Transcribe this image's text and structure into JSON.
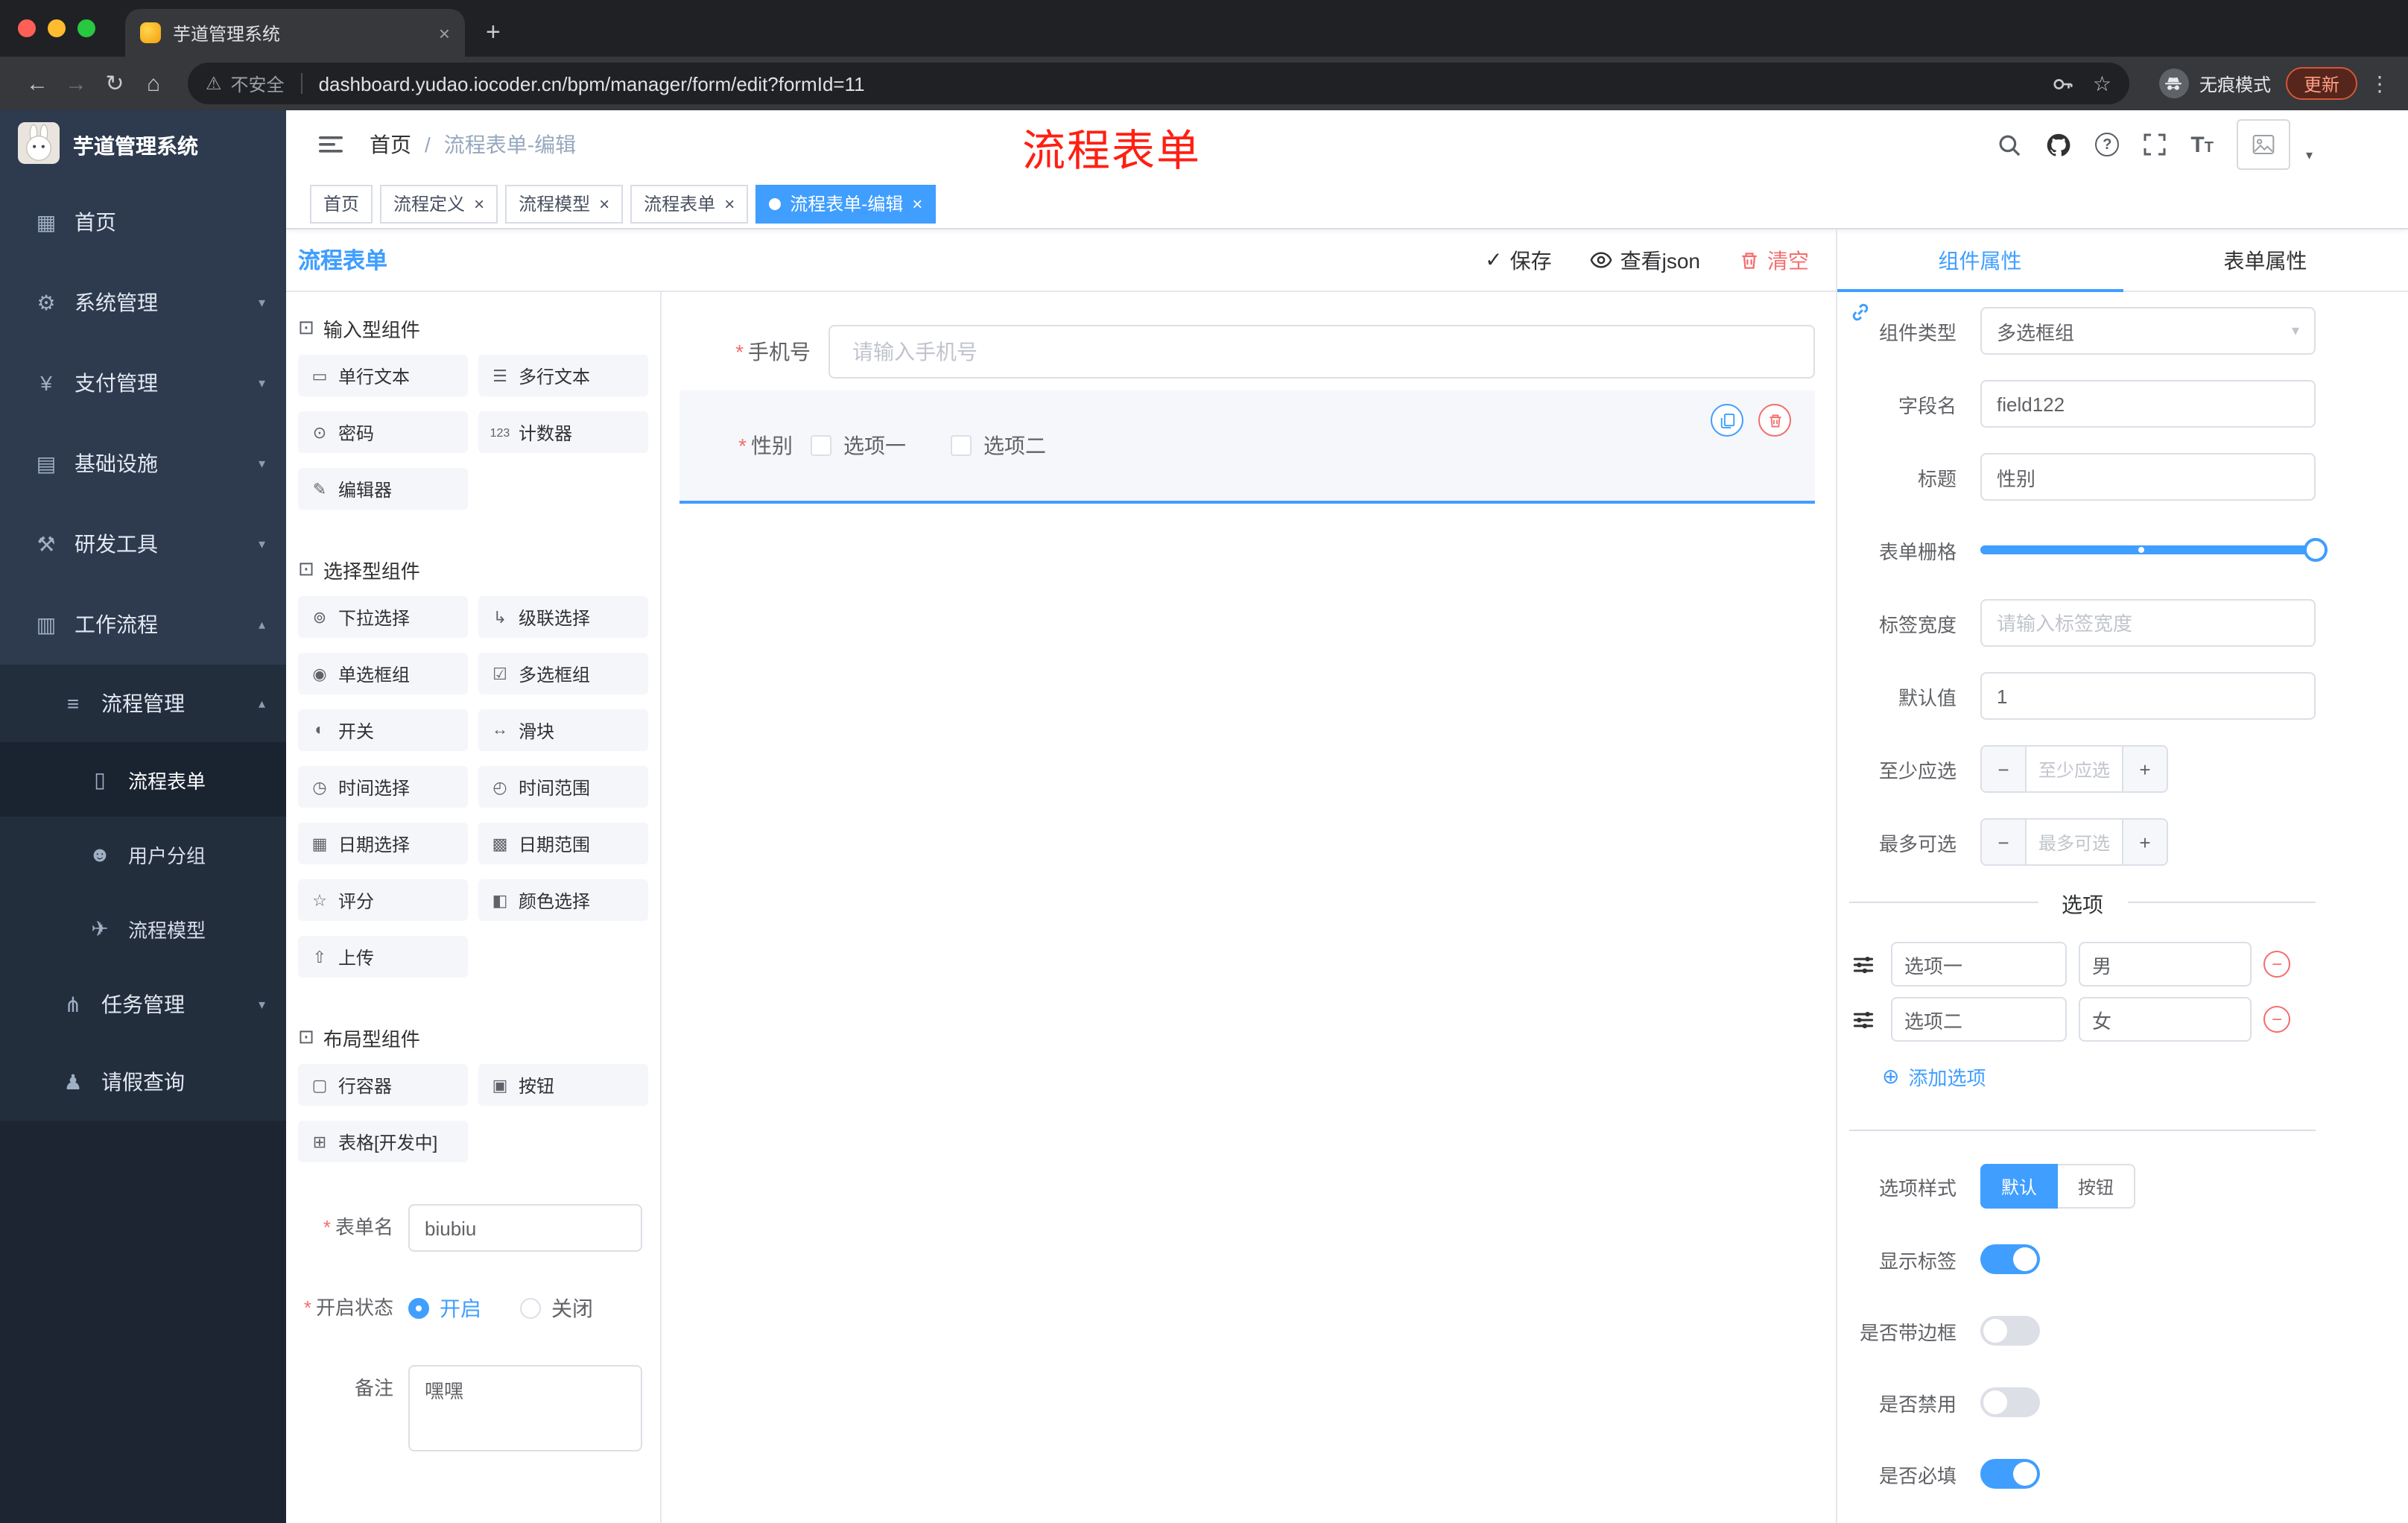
{
  "colors": {
    "primary": "#409eff",
    "danger": "#f56c6c",
    "annotation_red": "#ff1f12",
    "sidebar_bg": "#2e3a4e",
    "active_tag": "#409eff"
  },
  "browser": {
    "tab_title": "芋道管理系统",
    "security_label": "不安全",
    "url": "dashboard.yudao.iocoder.cn/bpm/manager/form/edit?formId=11",
    "incognito_label": "无痕模式",
    "update_label": "更新"
  },
  "sidebar": {
    "brand": "芋道管理系统",
    "items": [
      {
        "label": "首页"
      },
      {
        "label": "系统管理"
      },
      {
        "label": "支付管理"
      },
      {
        "label": "基础设施"
      },
      {
        "label": "研发工具"
      },
      {
        "label": "工作流程"
      },
      {
        "label": "流程管理"
      },
      {
        "label": "流程表单"
      },
      {
        "label": "用户分组"
      },
      {
        "label": "流程模型"
      },
      {
        "label": "任务管理"
      },
      {
        "label": "请假查询"
      }
    ]
  },
  "header": {
    "breadcrumb_home": "首页",
    "breadcrumb_sep": "/",
    "breadcrumb_current": "流程表单-编辑",
    "annotation": "流程表单"
  },
  "tags": [
    {
      "label": "首页"
    },
    {
      "label": "流程定义"
    },
    {
      "label": "流程模型"
    },
    {
      "label": "流程表单"
    },
    {
      "label": "流程表单-编辑"
    }
  ],
  "toolbar": {
    "save": "保存",
    "view_json": "查看json",
    "clear": "清空"
  },
  "palette": {
    "title": "流程表单",
    "groups": [
      {
        "title": "输入型组件",
        "items": [
          "单行文本",
          "多行文本",
          "密码",
          "计数器",
          "编辑器"
        ]
      },
      {
        "title": "选择型组件",
        "items": [
          "下拉选择",
          "级联选择",
          "单选框组",
          "多选框组",
          "开关",
          "滑块",
          "时间选择",
          "时间范围",
          "日期选择",
          "日期范围",
          "评分",
          "颜色选择",
          "上传"
        ]
      },
      {
        "title": "布局型组件",
        "items": [
          "行容器",
          "按钮",
          "表格[开发中]"
        ]
      }
    ],
    "form": {
      "name_label": "表单名",
      "name_value": "biubiu",
      "status_label": "开启状态",
      "status_on": "开启",
      "status_off": "关闭",
      "remark_label": "备注",
      "remark_value": "嘿嘿"
    }
  },
  "canvas": {
    "phone_label": "手机号",
    "phone_placeholder": "请输入手机号",
    "gender_label": "性别",
    "gender_opt1": "选项一",
    "gender_opt2": "选项二"
  },
  "props": {
    "tab_component": "组件属性",
    "tab_form": "表单属性",
    "component_type_label": "组件类型",
    "component_type_value": "多选框组",
    "field_label": "字段名",
    "field_value": "field122",
    "title_label": "标题",
    "title_value": "性别",
    "grid_label": "表单栅格",
    "label_width_label": "标签宽度",
    "label_width_placeholder": "请输入标签宽度",
    "default_label": "默认值",
    "default_value": "1",
    "min_label": "至少应选",
    "min_placeholder": "至少应选",
    "max_label": "最多可选",
    "max_placeholder": "最多可选",
    "options_title": "选项",
    "options": [
      {
        "label": "选项一",
        "value": "男"
      },
      {
        "label": "选项二",
        "value": "女"
      }
    ],
    "add_option": "添加选项",
    "style_label": "选项样式",
    "style_default": "默认",
    "style_button": "按钮",
    "switch_show_label": "显示标签",
    "switch_border": "是否带边框",
    "switch_disabled": "是否禁用",
    "switch_required": "是否必填"
  },
  "icons": {
    "close": "×",
    "new_tab": "+",
    "back": "←",
    "forward": "→",
    "reload": "↻",
    "home": "⌂",
    "warning": "⚠",
    "bookmark_star": "☆",
    "kebab": "⋮",
    "help": "?",
    "chevron_down": "▾",
    "chevron_up": "▴",
    "select_caret": "▾",
    "avatar_caret": "▾",
    "check": "✓",
    "minus": "−",
    "plus": "+",
    "add_circle": "⊕",
    "group_bullet": "⊡",
    "menu_home": "▦",
    "menu_system": "⚙",
    "menu_payment": "¥",
    "menu_infra": "▤",
    "menu_devtools": "⚒",
    "menu_workflow": "▥",
    "menu_process_mgmt": "≡",
    "menu_process_form": "▯",
    "menu_user_group": "☻",
    "menu_process_model": "✈",
    "menu_task": "⋔",
    "menu_leave": "♟",
    "chip_single_text": "▭",
    "chip_multi_text": "☰",
    "chip_password": "⊙",
    "chip_counter": "123",
    "chip_editor": "✎",
    "chip_select": "⊚",
    "chip_cascader": "↳",
    "chip_radio": "◉",
    "chip_checkbox": "☑",
    "chip_switch": "◐",
    "chip_sl": "↔",
    "chip_time": "◷",
    "chip_time_range": "◴",
    "chip_date": "▦",
    "chip_date_range": "▩",
    "chip_rate": "☆",
    "chip_color": "◧",
    "chip_upload": "⇧",
    "chip_row": "▢",
    "chip_button": "▣",
    "chip_table": "⊞"
  }
}
